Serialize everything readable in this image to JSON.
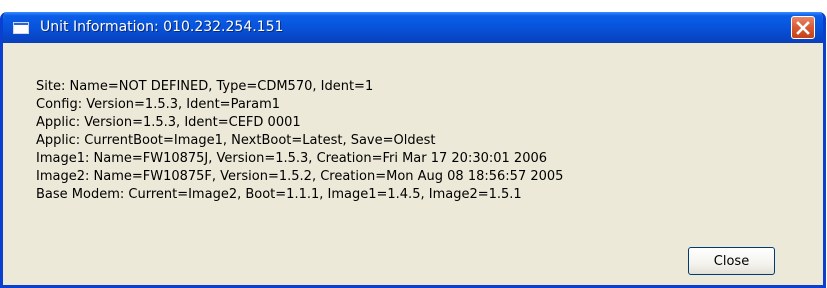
{
  "window": {
    "title": "Unit Information: 010.232.254.151",
    "icon": "window-icon",
    "close_icon": "close-icon"
  },
  "info_lines": [
    "Site: Name=NOT DEFINED, Type=CDM570, Ident=1",
    "Config: Version=1.5.3, Ident=Param1",
    "Applic: Version=1.5.3, Ident=CEFD 0001",
    "Applic: CurrentBoot=Image1, NextBoot=Latest, Save=Oldest",
    "Image1: Name=FW10875J, Version=1.5.3, Creation=Fri Mar 17 20:30:01 2006",
    "Image2: Name=FW10875F, Version=1.5.2, Creation=Mon Aug 08 18:56:57 2005",
    "Base Modem: Current=Image2, Boot=1.1.1, Image1=1.4.5, Image2=1.5.1"
  ],
  "buttons": {
    "close_label": "Close"
  },
  "colors": {
    "titlebar": "#0855dd",
    "window_bg": "#ece9d8",
    "close_title_button": "#d95a32"
  }
}
